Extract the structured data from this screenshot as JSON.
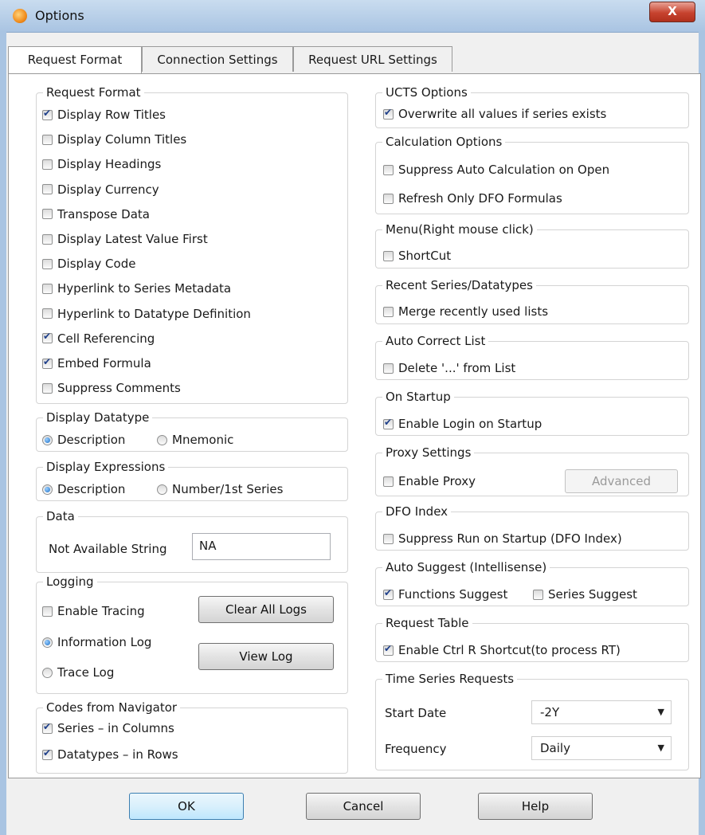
{
  "window": {
    "title": "Options",
    "close_glyph": "X"
  },
  "tabs": [
    {
      "label": "Request Format",
      "active": true
    },
    {
      "label": "Connection Settings",
      "active": false
    },
    {
      "label": "Request URL Settings",
      "active": false
    }
  ],
  "request_format": {
    "legend": "Request Format",
    "items": [
      {
        "label": "Display Row Titles",
        "checked": true
      },
      {
        "label": "Display Column Titles",
        "checked": false
      },
      {
        "label": "Display Headings",
        "checked": false
      },
      {
        "label": "Display Currency",
        "checked": false
      },
      {
        "label": "Transpose Data",
        "checked": false
      },
      {
        "label": "Display Latest Value First",
        "checked": false
      },
      {
        "label": "Display Code",
        "checked": false
      },
      {
        "label": "Hyperlink to Series Metadata",
        "checked": false
      },
      {
        "label": "Hyperlink to Datatype Definition",
        "checked": false
      },
      {
        "label": "Cell Referencing",
        "checked": true
      },
      {
        "label": "Embed Formula",
        "checked": true
      },
      {
        "label": "Suppress Comments",
        "checked": false
      }
    ]
  },
  "display_datatype": {
    "legend": "Display Datatype",
    "options": [
      {
        "label": "Description",
        "selected": true
      },
      {
        "label": "Mnemonic",
        "selected": false
      }
    ]
  },
  "display_expressions": {
    "legend": "Display Expressions",
    "options": [
      {
        "label": "Description",
        "selected": true
      },
      {
        "label": "Number/1st Series",
        "selected": false
      }
    ]
  },
  "data_group": {
    "legend": "Data",
    "field_label": "Not Available String",
    "field_value": "NA"
  },
  "logging": {
    "legend": "Logging",
    "enable_tracing": {
      "label": "Enable Tracing",
      "checked": false
    },
    "information_log": {
      "label": "Information Log",
      "selected": true
    },
    "trace_log": {
      "label": "Trace Log",
      "selected": false
    },
    "clear_button": "Clear All Logs",
    "view_button": "View Log"
  },
  "codes_from_navigator": {
    "legend": "Codes from Navigator",
    "items": [
      {
        "label": "Series – in Columns",
        "checked": true
      },
      {
        "label": "Datatypes – in Rows",
        "checked": true
      }
    ]
  },
  "ucts": {
    "legend": "UCTS Options",
    "item": {
      "label": "Overwrite all values if series exists",
      "checked": true
    }
  },
  "calculation": {
    "legend": "Calculation Options",
    "items": [
      {
        "label": "Suppress Auto Calculation on Open",
        "checked": false
      },
      {
        "label": "Refresh Only DFO Formulas",
        "checked": false
      }
    ]
  },
  "menu": {
    "legend": "Menu(Right mouse click)",
    "item": {
      "label": "ShortCut",
      "checked": false
    }
  },
  "recent": {
    "legend": "Recent Series/Datatypes",
    "item": {
      "label": "Merge recently used lists",
      "checked": false
    }
  },
  "autocorrect": {
    "legend": "Auto Correct List",
    "item": {
      "label": "Delete '...' from List",
      "checked": false
    }
  },
  "startup": {
    "legend": "On Startup",
    "item": {
      "label": "Enable Login on Startup",
      "checked": true
    }
  },
  "proxy": {
    "legend": "Proxy Settings",
    "item": {
      "label": "Enable Proxy",
      "checked": false
    },
    "advanced_button": "Advanced"
  },
  "dfo_index": {
    "legend": "DFO Index",
    "item": {
      "label": "Suppress Run on Startup (DFO Index)",
      "checked": false
    }
  },
  "auto_suggest": {
    "legend": "Auto Suggest (Intellisense)",
    "functions": {
      "label": "Functions Suggest",
      "checked": true
    },
    "series": {
      "label": "Series Suggest",
      "checked": false
    }
  },
  "request_table": {
    "legend": "Request Table",
    "item": {
      "label": "Enable Ctrl R Shortcut(to process RT)",
      "checked": true
    }
  },
  "time_series": {
    "legend": "Time Series Requests",
    "start_date_label": "Start Date",
    "start_date_value": "-2Y",
    "frequency_label": "Frequency",
    "frequency_value": "Daily"
  },
  "footer": {
    "ok": "OK",
    "cancel": "Cancel",
    "help": "Help"
  }
}
